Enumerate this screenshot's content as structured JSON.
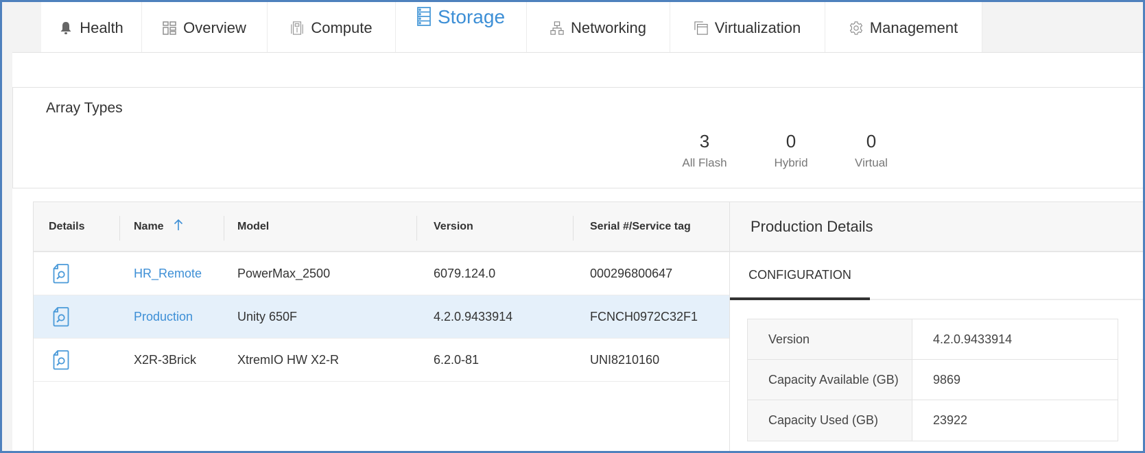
{
  "tabs": [
    {
      "label": "Health",
      "icon": "bell-icon",
      "active": false
    },
    {
      "label": "Overview",
      "icon": "dashboard-grid-icon",
      "active": false
    },
    {
      "label": "Compute",
      "icon": "server-rack-icon",
      "active": false
    },
    {
      "label": "Storage",
      "icon": "storage-icon",
      "active": true
    },
    {
      "label": "Networking",
      "icon": "network-topology-icon",
      "active": false
    },
    {
      "label": "Virtualization",
      "icon": "virtualization-icon",
      "active": false
    },
    {
      "label": "Management",
      "icon": "gear-icon",
      "active": false
    }
  ],
  "array_types": {
    "title": "Array Types",
    "stats": [
      {
        "value": "3",
        "label": "All Flash"
      },
      {
        "value": "0",
        "label": "Hybrid"
      },
      {
        "value": "0",
        "label": "Virtual"
      }
    ]
  },
  "table": {
    "columns": [
      "Details",
      "Name",
      "Model",
      "Version",
      "Serial #/Service tag"
    ],
    "sort": {
      "column": "Name",
      "direction": "ascending",
      "icon": "arrow-up-icon"
    },
    "rows": [
      {
        "name": "HR_Remote",
        "name_is_link": true,
        "model": "PowerMax_2500",
        "version": "6079.124.0",
        "serial": "000296800647",
        "selected": false
      },
      {
        "name": "Production",
        "name_is_link": true,
        "model": "Unity 650F",
        "version": "4.2.0.9433914",
        "serial": "FCNCH0972C32F1",
        "selected": true
      },
      {
        "name": "X2R-3Brick",
        "name_is_link": false,
        "model": "XtremIO HW X2-R",
        "version": "6.2.0-81",
        "serial": "UNI8210160",
        "selected": false
      }
    ]
  },
  "details": {
    "title": "Production Details",
    "tab": "CONFIGURATION",
    "config": [
      {
        "key": "Version",
        "value": "4.2.0.9433914"
      },
      {
        "key": "Capacity Available (GB)",
        "value": "9869"
      },
      {
        "key": "Capacity Used (GB)",
        "value": "23922"
      }
    ]
  },
  "colors": {
    "accent": "#3d8fd6",
    "frame_border": "#4f81bd",
    "selected_row": "#e5f0fa"
  }
}
